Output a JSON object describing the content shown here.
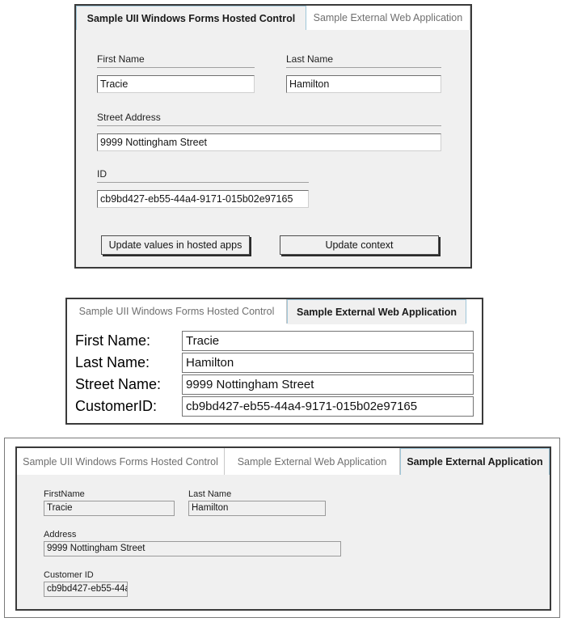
{
  "panel1": {
    "tabs": [
      {
        "label": "Sample UII Windows Forms Hosted Control",
        "active": true
      },
      {
        "label": "Sample External Web Application",
        "active": false
      }
    ],
    "fields": {
      "first_name_label": "First Name",
      "first_name_value": "Tracie",
      "last_name_label": "Last Name",
      "last_name_value": "Hamilton",
      "street_address_label": "Street Address",
      "street_address_value": "9999 Nottingham Street",
      "id_label": "ID",
      "id_value": "cb9bd427-eb55-44a4-9171-015b02e97165"
    },
    "buttons": {
      "update_values": "Update values in hosted apps",
      "update_context": "Update context"
    }
  },
  "panel2": {
    "tabs": [
      {
        "label": "Sample UII Windows Forms Hosted Control",
        "active": false
      },
      {
        "label": "Sample External Web Application",
        "active": true
      }
    ],
    "rows": [
      {
        "label": "First Name:",
        "value": "Tracie"
      },
      {
        "label": "Last Name:",
        "value": "Hamilton"
      },
      {
        "label": "Street Name:",
        "value": "9999 Nottingham Street"
      },
      {
        "label": "CustomerID:",
        "value": "cb9bd427-eb55-44a4-9171-015b02e97165"
      }
    ]
  },
  "panel3": {
    "tabs": [
      {
        "label": "Sample UII Windows Forms Hosted Control",
        "active": false
      },
      {
        "label": "Sample External Web Application",
        "active": false
      },
      {
        "label": "Sample External Application",
        "active": true
      }
    ],
    "fields": {
      "first_name_label": "FirstName",
      "first_name_value": "Tracie",
      "last_name_label": "Last Name",
      "last_name_value": "Hamilton",
      "address_label": "Address",
      "address_value": "9999 Nottingham Street",
      "customer_id_label": "Customer ID",
      "customer_id_value": "cb9bd427-eb55-44a"
    }
  },
  "colors": {
    "panel_border": "#3a3a3a",
    "panel_background": "#f0f0f0",
    "tab_inactive_text": "#6f6f6f",
    "tab_active_underline": "#9fc6d9"
  }
}
